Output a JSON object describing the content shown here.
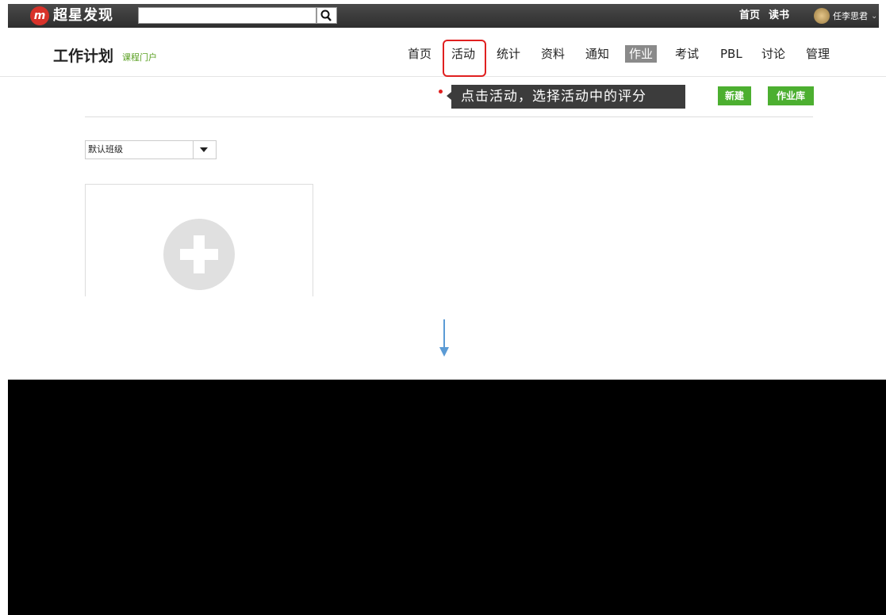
{
  "topbar": {
    "logo_glyph": "m",
    "brand": "超星发现",
    "search_value": "",
    "links": [
      {
        "label": "首页"
      },
      {
        "label": "读书"
      }
    ],
    "user_name": "任李思君",
    "user_caret": "⌄"
  },
  "course": {
    "title": "工作计划",
    "portal": "课程门户",
    "nav": [
      {
        "label": "首页"
      },
      {
        "label": "活动"
      },
      {
        "label": "统计"
      },
      {
        "label": "资料"
      },
      {
        "label": "通知"
      },
      {
        "label": "作业",
        "active": true
      },
      {
        "label": "考试"
      },
      {
        "label": "PBL"
      },
      {
        "label": "讨论"
      },
      {
        "label": "管理"
      }
    ]
  },
  "tooltip": "点击活动，选择活动中的评分",
  "buttons": {
    "new": "新建",
    "library": "作业库"
  },
  "class_select": {
    "value": "默认班级"
  },
  "colors": {
    "green": "#4caf30",
    "highlight": "#e02020",
    "arrow": "#5b9bd5"
  }
}
